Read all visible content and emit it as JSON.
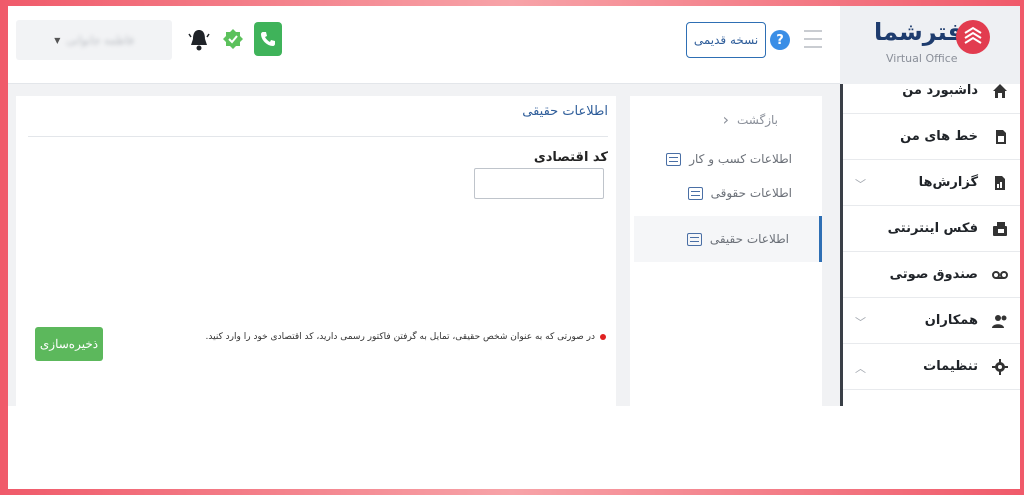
{
  "header": {
    "user_label": "فاطمه جانوانی",
    "old_version_label": "نسخه قدیمی",
    "help_label": "?"
  },
  "logo": {
    "brand": "دفترشما",
    "subtitle": "Virtual Office"
  },
  "form": {
    "title": "اطلاعات حقیقی",
    "field_label": "کد اقتصادی",
    "field_value": "",
    "note": "در صورتی که به عنوان شخص حقیقی، تمایل به گرفتن فاکتور رسمی دارید، کد اقتصادی خود را وارد کنید.",
    "save_label": "ذخیره‌سازی"
  },
  "subnav": {
    "back_label": "بازگشت",
    "items": [
      {
        "label": "اطلاعات کسب و کار"
      },
      {
        "label": "اطلاعات حقوقی"
      },
      {
        "label": "اطلاعات حقیقی"
      }
    ]
  },
  "sidebar": {
    "items": [
      {
        "label": "داشبورد من",
        "icon": "home-icon"
      },
      {
        "label": "خط های من",
        "icon": "sim-icon"
      },
      {
        "label": "گزارش‌ها",
        "icon": "report-icon"
      },
      {
        "label": "فکس اینترنتی",
        "icon": "fax-icon"
      },
      {
        "label": "صندوق صوتی",
        "icon": "voicemail-icon"
      },
      {
        "label": "همکاران",
        "icon": "users-icon"
      },
      {
        "label": "تنظیمات",
        "icon": "gear-icon"
      }
    ]
  },
  "colors": {
    "accent": "#2e6fb4",
    "save": "#5cb85c",
    "phone": "#3fb35a",
    "brand": "#e23c4f"
  }
}
